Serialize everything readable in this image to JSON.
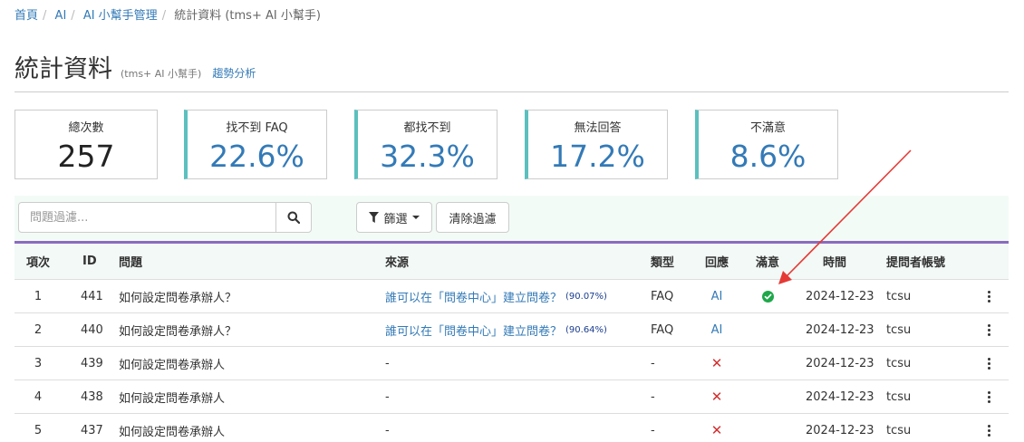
{
  "breadcrumb": {
    "items": [
      "首頁",
      "AI",
      "AI 小幫手管理"
    ],
    "current": "統計資料 (tms+ AI 小幫手)"
  },
  "header": {
    "title": "統計資料",
    "subtitle": "(tms+ AI 小幫手)",
    "trend_link": "趨勢分析"
  },
  "stats": [
    {
      "label": "總次數",
      "value": "257"
    },
    {
      "label": "找不到 FAQ",
      "value": "22.6%"
    },
    {
      "label": "都找不到",
      "value": "32.3%"
    },
    {
      "label": "無法回答",
      "value": "17.2%"
    },
    {
      "label": "不滿意",
      "value": "8.6%"
    }
  ],
  "toolbar": {
    "search_placeholder": "問題過濾...",
    "filter_label": "篩選",
    "clear_label": "清除過濾"
  },
  "table": {
    "columns": [
      "項次",
      "ID",
      "問題",
      "來源",
      "類型",
      "回應",
      "滿意",
      "時間",
      "提問者帳號"
    ],
    "rows": [
      {
        "idx": "1",
        "id": "441",
        "question": "如何設定問卷承辦人？",
        "source": "誰可以在「問卷中心」建立問卷？",
        "score": "(90.07%)",
        "type": "FAQ",
        "response": "AI",
        "response_kind": "ai",
        "satisfied": "check",
        "time": "2024-12-23",
        "user": "tcsu"
      },
      {
        "idx": "2",
        "id": "440",
        "question": "如何設定問卷承辦人？",
        "source": "誰可以在「問卷中心」建立問卷？",
        "score": "(90.64%)",
        "type": "FAQ",
        "response": "AI",
        "response_kind": "ai",
        "satisfied": "",
        "time": "2024-12-23",
        "user": "tcsu"
      },
      {
        "idx": "3",
        "id": "439",
        "question": "如何設定問卷承辦人",
        "source": "-",
        "score": "",
        "type": "-",
        "response": "✕",
        "response_kind": "none",
        "satisfied": "",
        "time": "2024-12-23",
        "user": "tcsu"
      },
      {
        "idx": "4",
        "id": "438",
        "question": "如何設定問卷承辦人",
        "source": "-",
        "score": "",
        "type": "-",
        "response": "✕",
        "response_kind": "none",
        "satisfied": "",
        "time": "2024-12-23",
        "user": "tcsu"
      },
      {
        "idx": "5",
        "id": "437",
        "question": "如何設定問卷承辦人",
        "source": "-",
        "score": "",
        "type": "-",
        "response": "✕",
        "response_kind": "none",
        "satisfied": "",
        "time": "2024-12-23",
        "user": "tcsu"
      }
    ]
  },
  "icons": {
    "search": "search-icon",
    "filter": "filter-icon",
    "check": "check-circle-icon",
    "cross": "x-icon",
    "menu": "kebab-menu-icon"
  },
  "colors": {
    "accent": "#337ab7",
    "card_border": "#5bc0be",
    "table_top": "#8a6bbf",
    "toolbar_bg": "#f3fbf7",
    "success": "#1ea84a",
    "danger": "#d32f2f",
    "annotation_arrow": "#e53935"
  }
}
